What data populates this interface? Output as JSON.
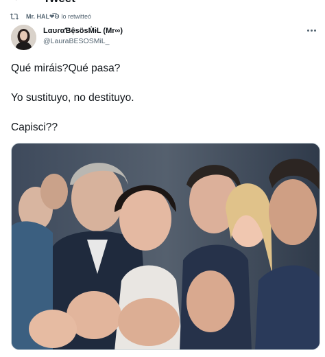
{
  "header": {
    "title": "Tweet",
    "back_icon": "arrow-left-icon"
  },
  "retweet": {
    "icon": "retweet-icon",
    "user": "Mr. HAL❤͠ʘ",
    "text": "lo retwitteó"
  },
  "author": {
    "display_name": "LαʊɾαƁệsösṀɨL (Mr∞)",
    "handle": "@LauraBESOSMiL_"
  },
  "tweet": {
    "lines": [
      "Qué miráis?Qué pasa?",
      "Yo sustituyo, no destituyo.",
      "Capisci??"
    ]
  },
  "more_icon": "more-horizontal-icon",
  "colors": {
    "text_primary": "#0f1419",
    "text_secondary": "#536471",
    "border": "#cfd9de"
  }
}
